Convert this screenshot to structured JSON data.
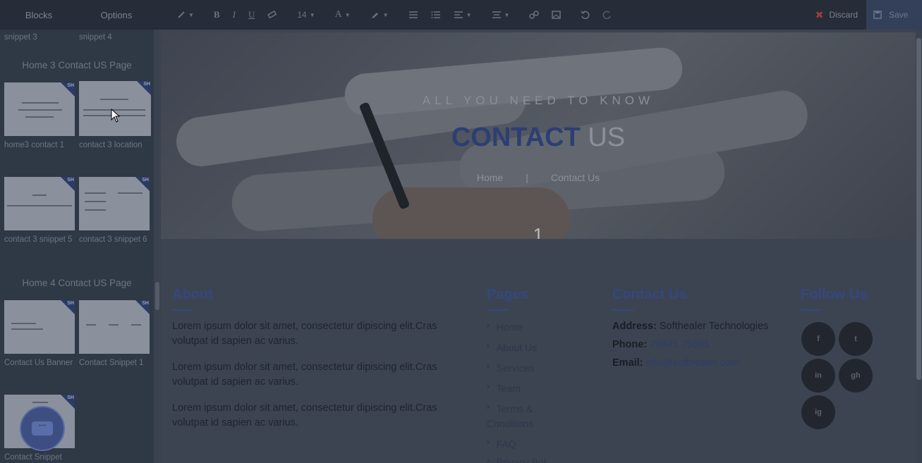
{
  "topbar": {
    "tabs": [
      "Blocks",
      "Options"
    ],
    "font_size": "14",
    "discard_label": "Discard",
    "save_label": "Save"
  },
  "sidebar": {
    "top_labels": [
      "snippet 3",
      "snippet 4"
    ],
    "groups": [
      {
        "title": "Home 3 Contact US Page",
        "snippets": [
          {
            "label": "home3 contact 1"
          },
          {
            "label": "contact 3 location"
          },
          {
            "label": "contact 3 snippet 5"
          },
          {
            "label": "contact 3 snippet 6"
          }
        ]
      },
      {
        "title": "Home 4 Contact US Page",
        "snippets": [
          {
            "label": "Contact Us Banner"
          },
          {
            "label": "Contact Snippet 1"
          },
          {
            "label": "Contact Snippet"
          }
        ]
      }
    ],
    "badge_text": "SH"
  },
  "hero": {
    "subtitle": "ALL YOU NEED TO KNOW",
    "title_highlight": "CONTACT",
    "title_rest": " US",
    "breadcrumb_home": "Home",
    "breadcrumb_sep": "|",
    "breadcrumb_current": "Contact Us",
    "slide_number": "1"
  },
  "footer": {
    "about": {
      "heading": "About",
      "paragraphs": [
        "Lorem ipsum dolor sit amet, consectetur dipiscing elit.Cras volutpat id sapien ac varius.",
        "Lorem ipsum dolor sit amet, consectetur dipiscing elit.Cras volutpat id sapien ac varius.",
        "Lorem ipsum dolor sit amet, consectetur dipiscing elit.Cras volutpat id sapien ac varius."
      ]
    },
    "pages": {
      "heading": "Pages",
      "links": [
        "Home",
        "About Us",
        "Services",
        "Team",
        "Terms &",
        "Conditions",
        "FAQ",
        "Privacy Pol"
      ]
    },
    "contact": {
      "heading": "Contact Us",
      "address_label": "Address:",
      "address_value": " Softhealer Technologies",
      "phone_label": "Phone:",
      "phone_value": " 79845 75661",
      "email_label": "Email:",
      "email_value": " info@softhealer.com"
    },
    "follow": {
      "heading": "Follow Us",
      "icons": [
        "f",
        "t",
        "in",
        "gh",
        "ig"
      ]
    }
  }
}
